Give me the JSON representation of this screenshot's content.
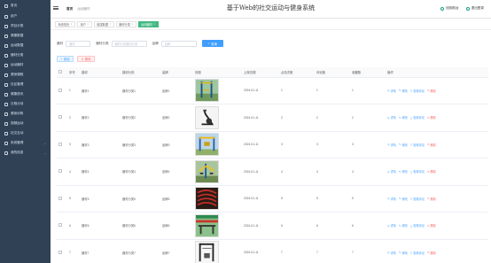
{
  "app": {
    "title": "基于Web的社交运动与健身系统"
  },
  "sidebar": {
    "items": [
      {
        "label": "首页",
        "icon": "home-icon"
      },
      {
        "label": "用户",
        "icon": "user-icon"
      },
      {
        "label": "项目分类",
        "icon": "category-icon"
      },
      {
        "label": "健康数据",
        "icon": "data-icon"
      },
      {
        "label": "运动数据",
        "icon": "sport-icon"
      },
      {
        "label": "器材分类",
        "icon": "category-icon"
      },
      {
        "label": "运动器材",
        "icon": "equipment-icon"
      },
      {
        "label": "健身课程",
        "icon": "course-icon"
      },
      {
        "label": "社区管理",
        "icon": "community-icon"
      },
      {
        "label": "健康资讯",
        "icon": "news-icon"
      },
      {
        "label": "日程计划",
        "icon": "calendar-icon"
      },
      {
        "label": "健身训练",
        "icon": "training-icon"
      },
      {
        "label": "视频运动",
        "icon": "video-icon"
      },
      {
        "label": "社交互动",
        "icon": "social-icon"
      },
      {
        "label": "系统管理",
        "icon": "settings-icon",
        "arrow": "⌄"
      },
      {
        "label": "我的信息",
        "icon": "profile-icon",
        "arrow": "⌄"
      }
    ]
  },
  "header": {
    "breadcrumb": [
      "首页",
      "运动器材"
    ],
    "links": [
      {
        "label": "回到前台",
        "icon": "home-icon"
      },
      {
        "label": "退出登录",
        "icon": "logout-icon"
      }
    ]
  },
  "tags": [
    {
      "label": "系统首页",
      "active": false
    },
    {
      "label": "用户",
      "active": false
    },
    {
      "label": "健康数据",
      "active": false
    },
    {
      "label": "器材分类",
      "active": false
    },
    {
      "label": "运动器材",
      "active": true
    }
  ],
  "search": {
    "field1": {
      "label": "器材",
      "placeholder": "器材"
    },
    "field2": {
      "label": "器材分类",
      "placeholder": "器材分类器材分类"
    },
    "field3": {
      "label": "品牌",
      "placeholder": "品牌"
    },
    "button": "查询"
  },
  "ops": {
    "add": "新增",
    "delete": "删除"
  },
  "table": {
    "columns": [
      "序号",
      "器材",
      "器材分类",
      "品牌",
      "封面",
      "上架日期",
      "点击次数",
      "评论数",
      "收藏数",
      "操作"
    ],
    "actions": {
      "view": "详情",
      "edit": "修改",
      "comment": "查看评论",
      "delete": "删除"
    },
    "rows": [
      {
        "idx": "1",
        "name": "器材1",
        "cat": "器材分类1",
        "brand": "品牌1",
        "date": "2024-01-11",
        "clicks": "1",
        "comments": "1",
        "favs": "1",
        "cover": "outdoor-pull-up"
      },
      {
        "idx": "2",
        "name": "器材2",
        "cat": "器材分类2",
        "brand": "品牌2",
        "date": "2024-01-11",
        "clicks": "2",
        "comments": "2",
        "favs": "2",
        "cover": "elliptical"
      },
      {
        "idx": "3",
        "name": "器材3",
        "cat": "器材分类3",
        "brand": "品牌3",
        "date": "2024-01-11",
        "clicks": "3",
        "comments": "3",
        "favs": "3",
        "cover": "outdoor-frame"
      },
      {
        "idx": "4",
        "name": "器材4",
        "cat": "器材分类4",
        "brand": "品牌4",
        "date": "2024-01-11",
        "clicks": "4",
        "comments": "4",
        "favs": "4",
        "cover": "outdoor-machine"
      },
      {
        "idx": "5",
        "name": "器材5",
        "cat": "器材分类5",
        "brand": "品牌5",
        "date": "2024-01-11",
        "clicks": "5",
        "comments": "5",
        "favs": "5",
        "cover": "ropes"
      },
      {
        "idx": "6",
        "name": "器材6",
        "cat": "器材分类6",
        "brand": "品牌6",
        "date": "2024-01-11",
        "clicks": "6",
        "comments": "6",
        "favs": "6",
        "cover": "outdoor-bench"
      },
      {
        "idx": "7",
        "name": "器材7",
        "cat": "器材分类7",
        "brand": "品牌7",
        "date": "2024-01-11",
        "clicks": "7",
        "comments": "7",
        "favs": "7",
        "cover": "cable-machine"
      }
    ]
  },
  "colors": {
    "sidebar": "#304156",
    "accent": "#409eff",
    "active_tag": "#42b983",
    "danger": "#f56c6c"
  }
}
